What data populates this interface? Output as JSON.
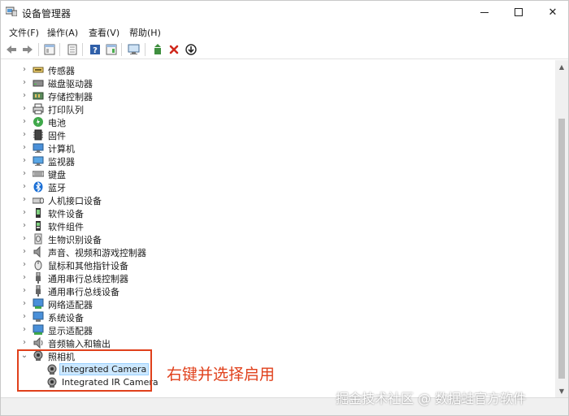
{
  "window": {
    "title": "设备管理器"
  },
  "title_controls": {
    "minimize": "—",
    "maximize": "☐",
    "close": "✕"
  },
  "menu": [
    {
      "label": "文件(F)"
    },
    {
      "label": "操作(A)"
    },
    {
      "label": "查看(V)"
    },
    {
      "label": "帮助(H)"
    }
  ],
  "toolbar": [
    {
      "icon": "back-arrow-icon"
    },
    {
      "icon": "forward-arrow-icon"
    },
    {
      "icon": "properties-panel-icon"
    },
    {
      "icon": "page-icon"
    },
    {
      "icon": "help-icon"
    },
    {
      "icon": "view-panel-icon"
    },
    {
      "icon": "monitor-scan-icon"
    },
    {
      "icon": "update-driver-icon"
    },
    {
      "icon": "uninstall-icon",
      "color": "#d0281c"
    },
    {
      "icon": "enable-device-icon"
    }
  ],
  "tree": {
    "categories": [
      {
        "label": "传感器",
        "icon": "sensor-icon"
      },
      {
        "label": "磁盘驱动器",
        "icon": "disk-drive-icon"
      },
      {
        "label": "存储控制器",
        "icon": "storage-controller-icon"
      },
      {
        "label": "打印队列",
        "icon": "printer-icon"
      },
      {
        "label": "电池",
        "icon": "battery-icon"
      },
      {
        "label": "固件",
        "icon": "firmware-icon"
      },
      {
        "label": "计算机",
        "icon": "computer-icon"
      },
      {
        "label": "监视器",
        "icon": "monitor-icon"
      },
      {
        "label": "键盘",
        "icon": "keyboard-icon"
      },
      {
        "label": "蓝牙",
        "icon": "bluetooth-icon"
      },
      {
        "label": "人机接口设备",
        "icon": "hid-icon"
      },
      {
        "label": "软件设备",
        "icon": "software-device-icon"
      },
      {
        "label": "软件组件",
        "icon": "software-component-icon"
      },
      {
        "label": "生物识别设备",
        "icon": "biometric-icon"
      },
      {
        "label": "声音、视频和游戏控制器",
        "icon": "speaker-icon"
      },
      {
        "label": "鼠标和其他指针设备",
        "icon": "mouse-icon"
      },
      {
        "label": "通用串行总线控制器",
        "icon": "usb-icon"
      },
      {
        "label": "通用串行总线设备",
        "icon": "usb-device-icon"
      },
      {
        "label": "网络适配器",
        "icon": "network-adapter-icon"
      },
      {
        "label": "系统设备",
        "icon": "system-device-icon"
      },
      {
        "label": "显示适配器",
        "icon": "display-adapter-icon"
      },
      {
        "label": "音频输入和输出",
        "icon": "audio-io-icon"
      }
    ],
    "camera": {
      "label": "照相机",
      "icon": "camera-icon",
      "children": [
        {
          "label": "Integrated Camera",
          "icon": "webcam-icon",
          "selected": true
        },
        {
          "label": "Integrated IR Camera",
          "icon": "webcam-icon",
          "selected": false
        }
      ]
    }
  },
  "annotation": {
    "text": "右键并选择启用",
    "color": "#e0401b"
  },
  "watermark": {
    "text": "掘金技术社区 @ 数据蛙官方软件"
  },
  "colors": {
    "selection_bg": "#cce8ff",
    "selection_border": "#99d1ff",
    "accent": "#e0401b"
  }
}
